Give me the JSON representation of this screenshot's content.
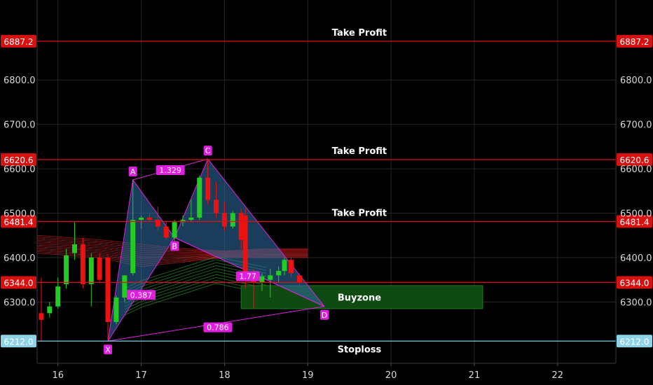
{
  "chart_data": {
    "type": "candlestick",
    "x_ticks": [
      "16",
      "17",
      "18",
      "19",
      "20",
      "21",
      "22"
    ],
    "y_ticks": [
      "6300.0",
      "6400.0",
      "6500.0",
      "6600.0",
      "6700.0",
      "6800.0"
    ],
    "ylim": [
      6162,
      6980
    ],
    "xlim": [
      15.75,
      22.7
    ],
    "grid": true,
    "colors": {
      "up": "#22cc22",
      "down": "#ee1111",
      "level_line": "#e01010",
      "stop_line": "#7fd0e0",
      "pattern": "#e01ee0",
      "buyzone": "#0f4a12"
    },
    "levels": [
      {
        "price": 6887.2,
        "label": "6887.2",
        "note": "Take Profit",
        "kind": "tp"
      },
      {
        "price": 6620.6,
        "label": "6620.6",
        "note": "Take Profit",
        "kind": "tp"
      },
      {
        "price": 6481.4,
        "label": "6481.4",
        "note": "Take Profit",
        "kind": "tp"
      },
      {
        "price": 6344.0,
        "label": "6344.0",
        "note": "",
        "kind": "tp"
      },
      {
        "price": 6212.0,
        "label": "6212.0",
        "note": "Stoploss",
        "kind": "sl"
      }
    ],
    "buyzone": {
      "label": "Buyzone",
      "x_start": 18.2,
      "x_end": 21.1,
      "y_low": 6285,
      "y_high": 6337
    },
    "pattern": {
      "points": [
        {
          "label": "X",
          "x": 16.6,
          "y": 6212
        },
        {
          "label": "A",
          "x": 16.9,
          "y": 6575
        },
        {
          "label": "B",
          "x": 17.4,
          "y": 6445
        },
        {
          "label": "C",
          "x": 17.8,
          "y": 6622
        },
        {
          "label": "D",
          "x": 19.2,
          "y": 6290
        }
      ],
      "ratios": [
        {
          "label": "1.329",
          "x": 17.35,
          "y": 6597
        },
        {
          "label": "0.387",
          "x": 17.0,
          "y": 6316
        },
        {
          "label": "1.77",
          "x": 18.28,
          "y": 6358
        },
        {
          "label": "0.786",
          "x": 17.92,
          "y": 6243
        }
      ]
    },
    "candles": [
      {
        "x": 15.8,
        "o": 6275,
        "h": 6355,
        "l": 6212,
        "c": 6260
      },
      {
        "x": 15.9,
        "o": 6275,
        "h": 6300,
        "l": 6265,
        "c": 6290
      },
      {
        "x": 16.0,
        "o": 6290,
        "h": 6355,
        "l": 6285,
        "c": 6335
      },
      {
        "x": 16.1,
        "o": 6340,
        "h": 6420,
        "l": 6330,
        "c": 6405
      },
      {
        "x": 16.2,
        "o": 6410,
        "h": 6480,
        "l": 6395,
        "c": 6430
      },
      {
        "x": 16.3,
        "o": 6430,
        "h": 6445,
        "l": 6330,
        "c": 6340
      },
      {
        "x": 16.4,
        "o": 6340,
        "h": 6410,
        "l": 6290,
        "c": 6400
      },
      {
        "x": 16.5,
        "o": 6400,
        "h": 6410,
        "l": 6345,
        "c": 6350
      },
      {
        "x": 16.6,
        "o": 6400,
        "h": 6405,
        "l": 6212,
        "c": 6255
      },
      {
        "x": 16.7,
        "o": 6255,
        "h": 6315,
        "l": 6250,
        "c": 6310
      },
      {
        "x": 16.8,
        "o": 6310,
        "h": 6360,
        "l": 6300,
        "c": 6360
      },
      {
        "x": 16.9,
        "o": 6365,
        "h": 6575,
        "l": 6360,
        "c": 6485
      },
      {
        "x": 17.0,
        "o": 6485,
        "h": 6495,
        "l": 6465,
        "c": 6490
      },
      {
        "x": 17.1,
        "o": 6490,
        "h": 6500,
        "l": 6480,
        "c": 6485
      },
      {
        "x": 17.2,
        "o": 6485,
        "h": 6515,
        "l": 6460,
        "c": 6470
      },
      {
        "x": 17.3,
        "o": 6470,
        "h": 6480,
        "l": 6440,
        "c": 6445
      },
      {
        "x": 17.4,
        "o": 6445,
        "h": 6485,
        "l": 6435,
        "c": 6480
      },
      {
        "x": 17.5,
        "o": 6480,
        "h": 6495,
        "l": 6470,
        "c": 6485
      },
      {
        "x": 17.6,
        "o": 6485,
        "h": 6530,
        "l": 6480,
        "c": 6490
      },
      {
        "x": 17.7,
        "o": 6490,
        "h": 6585,
        "l": 6485,
        "c": 6580
      },
      {
        "x": 17.8,
        "o": 6580,
        "h": 6622,
        "l": 6520,
        "c": 6530
      },
      {
        "x": 17.9,
        "o": 6530,
        "h": 6570,
        "l": 6490,
        "c": 6500
      },
      {
        "x": 18.0,
        "o": 6500,
        "h": 6525,
        "l": 6460,
        "c": 6470
      },
      {
        "x": 18.1,
        "o": 6470,
        "h": 6505,
        "l": 6465,
        "c": 6500
      },
      {
        "x": 18.2,
        "o": 6500,
        "h": 6510,
        "l": 6420,
        "c": 6440
      },
      {
        "x": 18.25,
        "o": 6495,
        "h": 6510,
        "l": 6330,
        "c": 6350
      },
      {
        "x": 18.35,
        "o": 6350,
        "h": 6375,
        "l": 6285,
        "c": 6345
      },
      {
        "x": 18.45,
        "o": 6345,
        "h": 6365,
        "l": 6325,
        "c": 6358
      },
      {
        "x": 18.55,
        "o": 6350,
        "h": 6375,
        "l": 6310,
        "c": 6360
      },
      {
        "x": 18.65,
        "o": 6360,
        "h": 6380,
        "l": 6345,
        "c": 6370
      },
      {
        "x": 18.72,
        "o": 6370,
        "h": 6400,
        "l": 6360,
        "c": 6395
      },
      {
        "x": 18.8,
        "o": 6395,
        "h": 6400,
        "l": 6355,
        "c": 6365
      },
      {
        "x": 18.9,
        "o": 6360,
        "h": 6365,
        "l": 6330,
        "c": 6345
      }
    ]
  }
}
